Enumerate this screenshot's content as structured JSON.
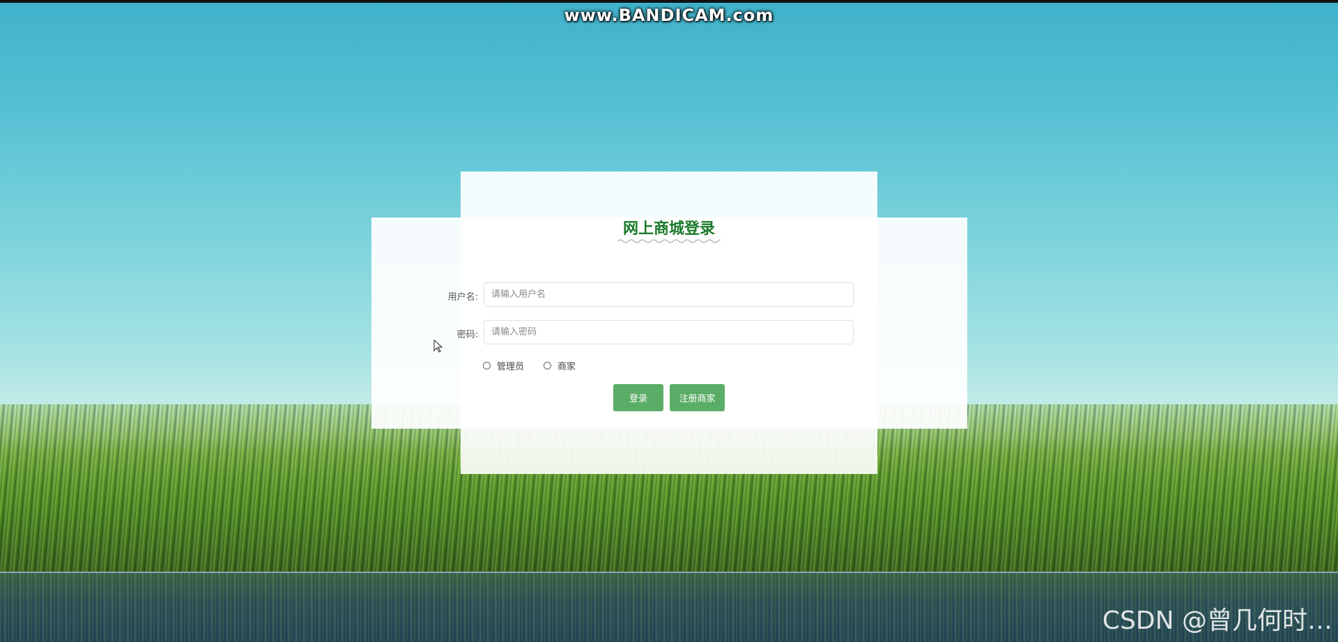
{
  "watermarks": {
    "top": "www.BANDICAM.com",
    "bottom": "CSDN @曾几何时…"
  },
  "login": {
    "title": "网上商城登录",
    "username_label": "用户名:",
    "username_placeholder": "请输入用户名",
    "username_value": "",
    "password_label": "密码:",
    "password_placeholder": "请输入密码",
    "password_value": "",
    "roles": [
      {
        "label": "管理员",
        "selected": false
      },
      {
        "label": "商家",
        "selected": false
      }
    ],
    "login_button": "登录",
    "register_button": "注册商家"
  },
  "colors": {
    "title": "#1a7a2a",
    "button": "#5aad66"
  },
  "icons": {
    "cursor": "mouse-pointer-icon",
    "wave": "wavy-underline"
  }
}
